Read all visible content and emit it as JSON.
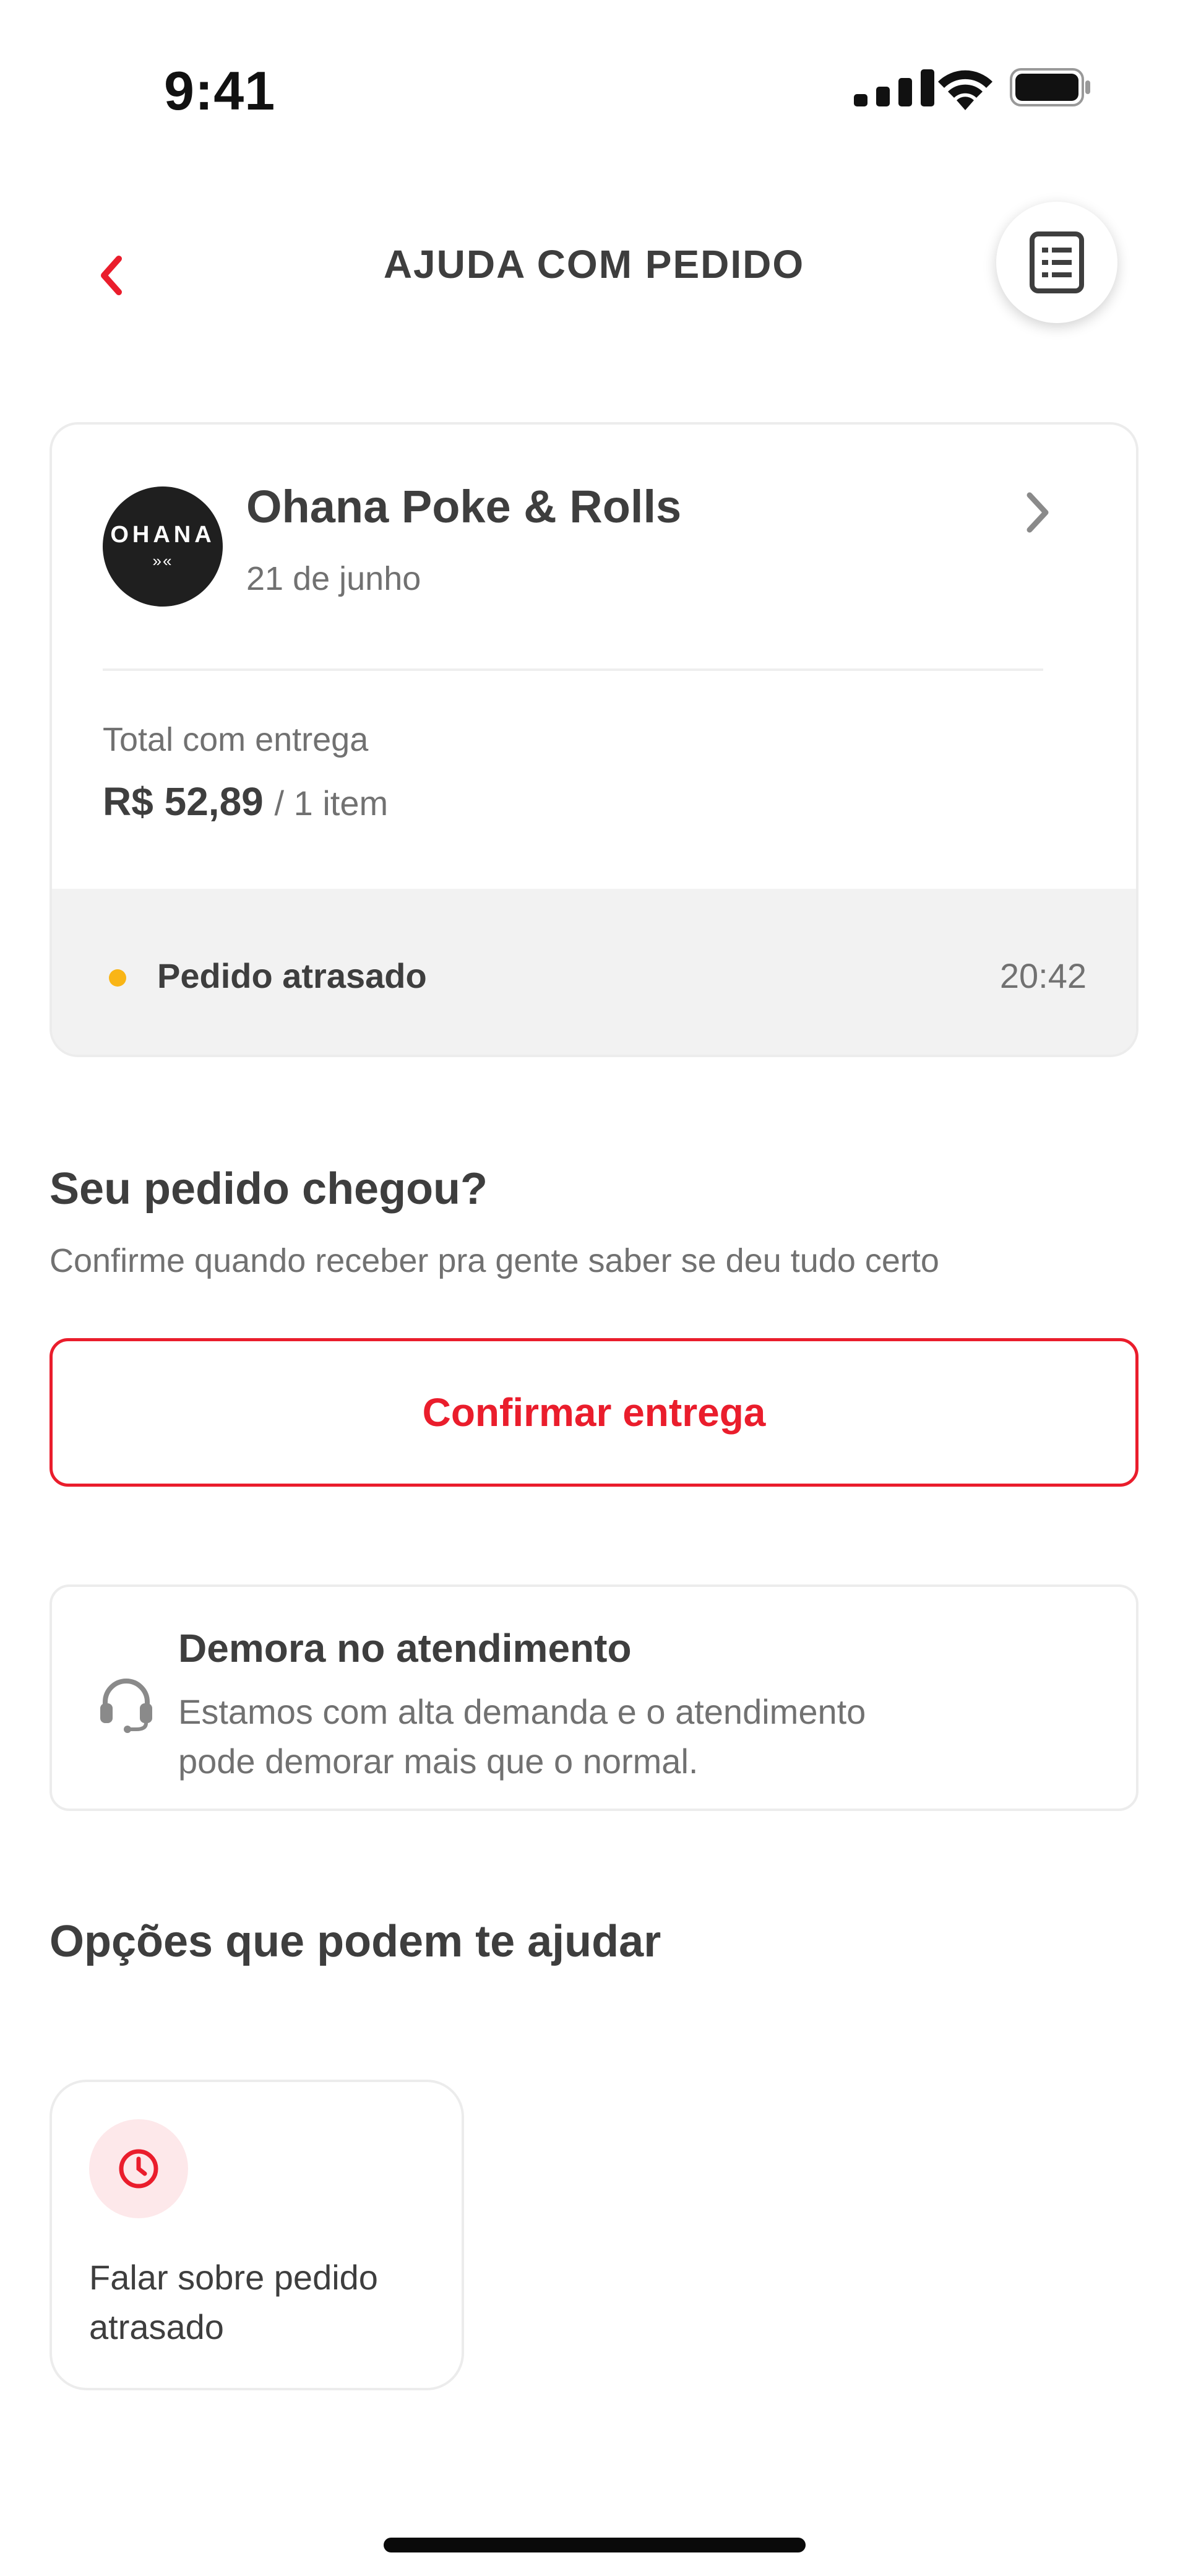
{
  "status_bar": {
    "time": "9:41",
    "icons": [
      "cellular-signal-icon",
      "wifi-icon",
      "battery-icon"
    ]
  },
  "header": {
    "back_icon": "chevron-left-icon",
    "title": "AJUDA COM PEDIDO",
    "receipt_icon": "receipt-icon"
  },
  "order": {
    "restaurant_logo_text": "OHANA",
    "restaurant_name": "Ohana Poke & Rolls",
    "date": "21 de junho",
    "total_label": "Total com entrega",
    "total_value": "R$ 52,89",
    "items": "/ 1 item",
    "status": "Pedido atrasado",
    "status_time": "20:42"
  },
  "arrived": {
    "title": "Seu pedido chegou?",
    "subtitle": "Confirme quando receber pra gente saber se deu tudo certo",
    "confirm_label": "Confirmar entrega"
  },
  "notice": {
    "icon": "headset-icon",
    "title": "Demora no atendimento",
    "body": "Estamos com alta demanda e o atendimento pode demorar mais que o normal."
  },
  "options": {
    "title": "Opções que podem te ajudar",
    "items": [
      {
        "icon": "clock-icon",
        "label": "Falar sobre pedido atrasado"
      }
    ]
  },
  "colors": {
    "accent_red": "#ea1d2c",
    "status_yellow": "#f9b516",
    "text_dark": "#3e3e3e",
    "text_muted": "#717171"
  }
}
